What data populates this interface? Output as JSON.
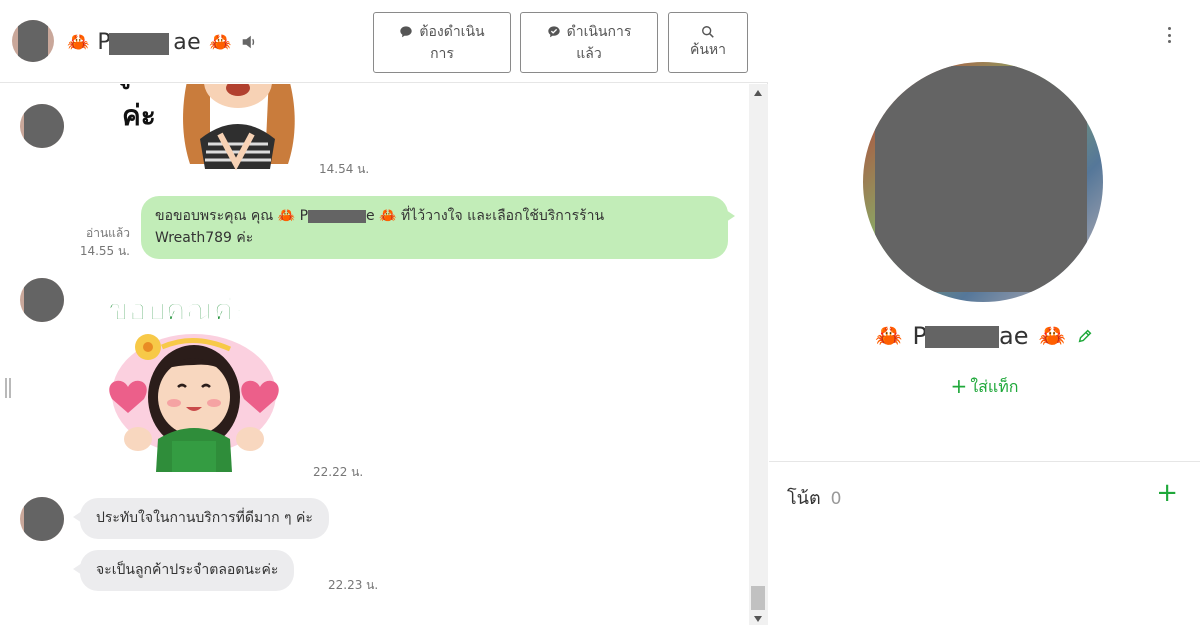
{
  "header": {
    "name_prefix": "P",
    "name_suffix": "ae",
    "buttons": {
      "todo_line1": "ต้องดำเนิน",
      "todo_line2": "การ",
      "done_line1": "ดำเนินการ",
      "done_line2": "แล้ว",
      "search": "ค้นหา"
    }
  },
  "chat": {
    "messages": [
      {
        "type": "sticker",
        "sticker_text": "ค่ะ",
        "time": "14.54 น."
      },
      {
        "type": "outgoing",
        "read_label": "อ่านแล้ว",
        "read_time": "14.55 น.",
        "text_before": "ขอขอบพระคุณ   คุณ 🦀 P",
        "text_after": "e 🦀 ที่ไว้วางใจ และเลือกใช้บริการร้าน",
        "text_line2": "Wreath789 ค่ะ"
      },
      {
        "type": "sticker",
        "sticker_text": "ขอบคุณค่ะ",
        "time": "22.22 น."
      },
      {
        "type": "incoming",
        "text": "ประทับใจในกานบริการที่ดีมาก ๆ ค่ะ"
      },
      {
        "type": "incoming",
        "text": "จะเป็นลูกค้าประจำตลอดนะค่ะ",
        "time": "22.23 น."
      }
    ]
  },
  "profile": {
    "name_prefix": "P",
    "name_suffix": "ae",
    "add_tag_label": "ใส่แท็ก",
    "notes_label": "โน้ต",
    "notes_count": "0"
  },
  "colors": {
    "accent_green": "#1fa83a",
    "outgoing_bubble": "#c2edb8",
    "incoming_bubble": "#ececee",
    "redaction": "#646464"
  },
  "icons": [
    "crab-icon",
    "speaker-icon",
    "chat-bubble-icon",
    "search-icon",
    "more-vertical-icon",
    "pencil-icon",
    "plus-icon"
  ]
}
